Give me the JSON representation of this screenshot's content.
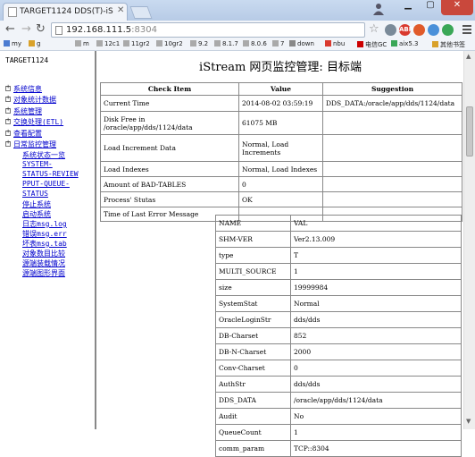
{
  "browser": {
    "tab_title": "TARGET1124 DDS(T)-iS",
    "url_host": "192.168.111.5",
    "url_port": ":8304",
    "bookmarks": [
      "my",
      "g",
      "m",
      "12c1",
      "11gr2",
      "10gr2",
      "9.2",
      "8.1.7",
      "8.0.6",
      "7",
      "down",
      "nbu",
      "电信GC",
      "aix5.3",
      "其他书签"
    ],
    "extension_labels": [
      "ABP"
    ]
  },
  "sidebar": {
    "title": "TARGET1124",
    "items": [
      "系统信息",
      "对象统计数据",
      "系统管理",
      "交换处理(ETL)",
      "查看配置",
      "日常监控管理"
    ],
    "subitems": [
      "系统状态一览",
      "SYSTEM-",
      "STATUS-REVIEW",
      "PPUT-QUEUE-",
      "STATUS",
      "停止系统",
      "启动系统",
      "日志msg.log",
      "错误msg.err",
      "坏表msg.tab",
      "对象数目比较",
      "源端装载情况",
      "源端图形界面"
    ]
  },
  "main": {
    "title": "iStream 网页监控管理: 目标端",
    "columns": [
      "Check Item",
      "Value",
      "Suggestion"
    ],
    "rows": [
      {
        "item": "Current Time",
        "value": "2014-08-02 03:59:19",
        "suggestion": "DDS_DATA:/oracle/app/dds/1124/data"
      },
      {
        "item": "Disk Free in\n/oracle/app/dds/1124/data",
        "value": "61075 MB",
        "suggestion": ""
      },
      {
        "item": "Load Increment Data",
        "value": "Normal, Load\nIncrements",
        "suggestion": ""
      },
      {
        "item": "Load Indexes",
        "value": "Normal, Load Indexes",
        "suggestion": ""
      },
      {
        "item": "Amount of BAD-TABLES",
        "value": "0",
        "suggestion": ""
      },
      {
        "item": "Process' Stutas",
        "value": "OK",
        "suggestion": ""
      },
      {
        "item": "Time of Last Error Message",
        "value": "",
        "suggestion": ""
      }
    ],
    "params": [
      {
        "name": "NAME",
        "value": "VAL"
      },
      {
        "name": "SHM-VER",
        "value": "Ver2.13.009"
      },
      {
        "name": "type",
        "value": "T"
      },
      {
        "name": "MULTI_SOURCE",
        "value": "1"
      },
      {
        "name": "size",
        "value": "19999984"
      },
      {
        "name": "SystemStat",
        "value": "Normal"
      },
      {
        "name": "OracleLoginStr",
        "value": "dds/dds"
      },
      {
        "name": "DB-Charset",
        "value": "852"
      },
      {
        "name": "DB-N-Charset",
        "value": "2000"
      },
      {
        "name": "Conv-Charset",
        "value": "0"
      },
      {
        "name": "AuthStr",
        "value": "dds/dds"
      },
      {
        "name": "DDS_DATA",
        "value": "/oracle/app/dds/1124/data"
      },
      {
        "name": "Audit",
        "value": "No"
      },
      {
        "name": "QueueCount",
        "value": "1"
      },
      {
        "name": "comm_param",
        "value": "TCP::8304"
      }
    ]
  }
}
